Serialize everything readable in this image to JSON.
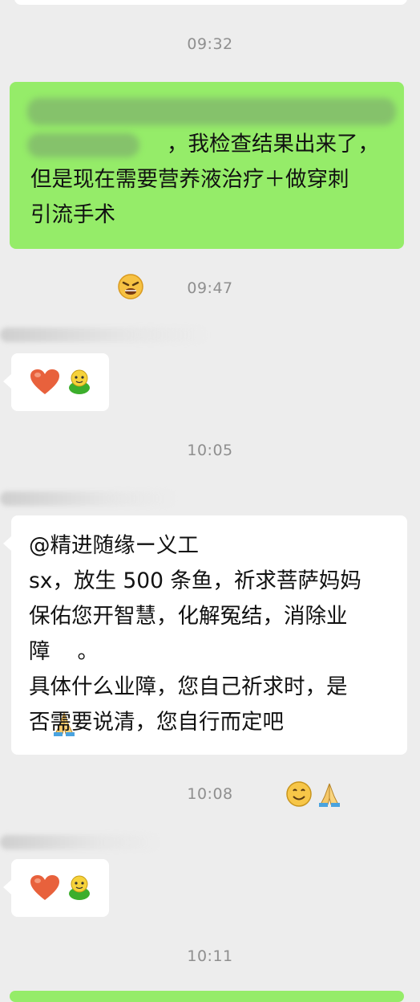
{
  "messages": {
    "time1": "09:32",
    "msg1": {
      "line3": "但是现在需要营养液治疗＋做穿刺",
      "line4": "引流手术"
    },
    "time2": "09:47",
    "time3": "10:05",
    "msg3": {
      "line1": "@精进随缘ー义工",
      "line2": "sx，放生 500 条鱼，祈求菩萨妈妈",
      "line3": "保佑您开智慧，化解冤结，消除业",
      "line4": "障",
      "line4b": "。",
      "line5": "具体什么业障，您自己祈求时，是",
      "line6": "否需要说清，您自行而定吧"
    },
    "time4": "10:08",
    "time5": "10:11"
  },
  "icons": {
    "heart": "heart-emoji",
    "thumb": "green-bean-emoji",
    "prayer": "folded-hands-emoji",
    "smile": "smile-emoji",
    "weary": "weary-face-emoji"
  },
  "colors": {
    "background": "#ededed",
    "sent_bubble": "#95ec69",
    "received_bubble": "#ffffff",
    "timestamp": "#8f8f8f"
  }
}
